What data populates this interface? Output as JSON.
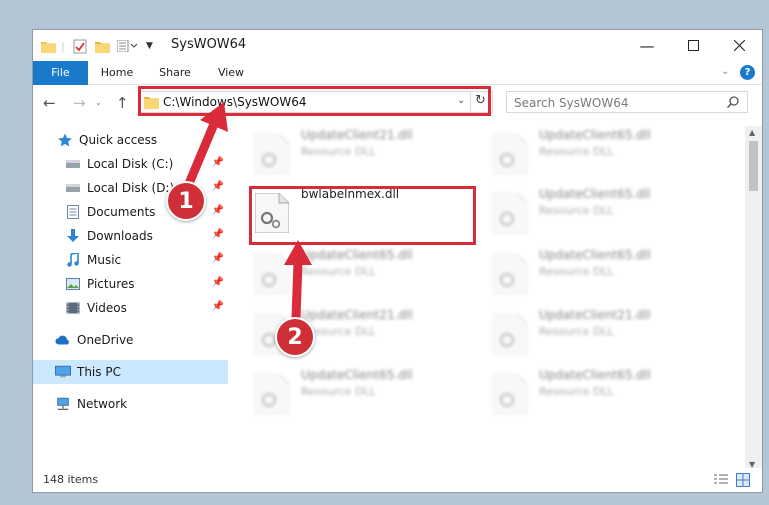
{
  "window": {
    "title": "SysWOW64"
  },
  "ribbon": {
    "tabs": [
      "File",
      "Home",
      "Share",
      "View"
    ],
    "accent": "#1979ca"
  },
  "address": {
    "path": "C:\\Windows\\SysWOW64",
    "search_placeholder": "Search SysWOW64"
  },
  "nav": {
    "items": [
      {
        "label": "Quick access",
        "icon": "star-icon"
      },
      {
        "label": "Local Disk (C:)",
        "icon": "drive-icon",
        "pinned": true
      },
      {
        "label": "Local Disk (D:)",
        "icon": "drive-icon",
        "pinned": true
      },
      {
        "label": "Documents",
        "icon": "documents-icon",
        "pinned": true
      },
      {
        "label": "Downloads",
        "icon": "download-icon",
        "pinned": true
      },
      {
        "label": "Music",
        "icon": "music-icon",
        "pinned": true
      },
      {
        "label": "Pictures",
        "icon": "pictures-icon",
        "pinned": true
      },
      {
        "label": "Videos",
        "icon": "videos-icon",
        "pinned": true
      },
      {
        "label": "OneDrive",
        "icon": "cloud-icon"
      },
      {
        "label": "This PC",
        "icon": "computer-icon",
        "selected": true
      },
      {
        "label": "Network",
        "icon": "network-icon"
      }
    ]
  },
  "files": {
    "col1": [
      {
        "name": "UpdateClient21.dll",
        "type": "Resource DLL"
      },
      {
        "name": "bwlabelnmex.dll",
        "type": ""
      },
      {
        "name": "UpdateClient65.dll",
        "type": "Resource DLL"
      },
      {
        "name": "UpdateClient21.dll",
        "type": "Resource DLL"
      },
      {
        "name": "UpdateClient65.dll",
        "type": "Resource DLL"
      }
    ],
    "col2": [
      {
        "name": "UpdateClient65.dll",
        "type": "Resource DLL"
      },
      {
        "name": "UpdateClient65.dll",
        "type": "Resource DLL"
      },
      {
        "name": "UpdateClient65.dll",
        "type": "Resource DLL"
      },
      {
        "name": "UpdateClient21.dll",
        "type": "Resource DLL"
      },
      {
        "name": "UpdateClient65.dll",
        "type": "Resource DLL"
      }
    ]
  },
  "status": {
    "item_count": "148 items"
  },
  "annotations": {
    "step1": "1",
    "step2": "2",
    "color": "#d92b3a"
  }
}
